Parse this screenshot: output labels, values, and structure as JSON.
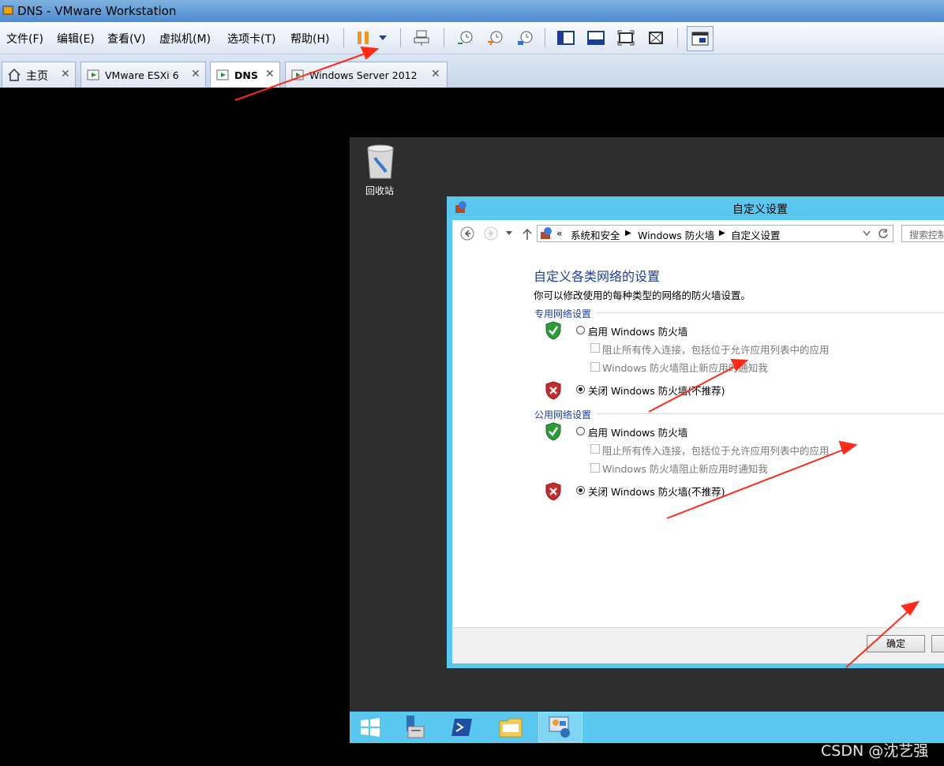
{
  "window": {
    "title": "DNS - VMware Workstation"
  },
  "menu": {
    "items": [
      "文件(F)",
      "编辑(E)",
      "查看(V)",
      "虚拟机(M)",
      "选项卡(T)",
      "帮助(H)"
    ]
  },
  "tabs": [
    {
      "label": "主页"
    },
    {
      "label": "VMware ESXi 6"
    },
    {
      "label": "DNS"
    },
    {
      "label": "Windows Server 2012"
    }
  ],
  "desktop": {
    "recycle_bin": "回收站"
  },
  "dialog": {
    "title": "自定义设置",
    "breadcrumb": {
      "prefix": "«",
      "items": [
        "系统和安全",
        "Windows 防火墙",
        "自定义设置"
      ]
    },
    "search_placeholder": "搜索控制",
    "heading": "自定义各类网络的设置",
    "description": "你可以修改使用的每种类型的网络的防火墙设置。",
    "private": {
      "section": "专用网络设置",
      "enable": "启用 Windows 防火墙",
      "block_all": "阻止所有传入连接，包括位于允许应用列表中的应用",
      "notify": "Windows 防火墙阻止新应用时通知我",
      "disable": "关闭 Windows 防火墙(不推荐)"
    },
    "public": {
      "section": "公用网络设置",
      "enable": "启用 Windows 防火墙",
      "block_all": "阻止所有传入连接，包括位于允许应用列表中的应用",
      "notify": "Windows 防火墙阻止新应用时通知我",
      "disable": "关闭 Windows 防火墙(不推荐)"
    },
    "ok_label": "确定"
  },
  "watermark": "CSDN @沈艺强",
  "colors": {
    "dialog_frame": "#5ac8ee",
    "heading": "#1e3e9f",
    "annotation_arrow": "#ff2a1a"
  }
}
